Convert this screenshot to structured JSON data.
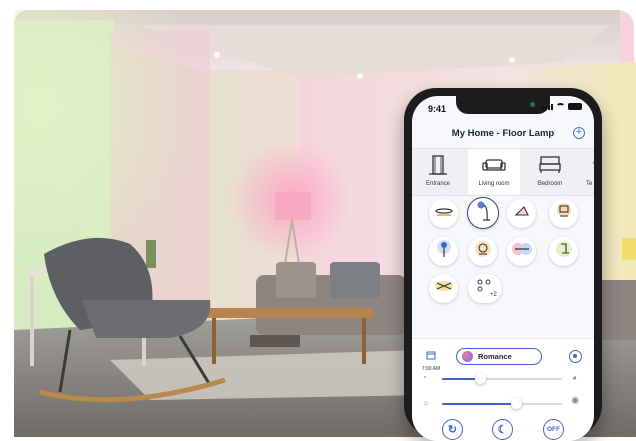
{
  "status": {
    "time": "9:41"
  },
  "header": {
    "title": "My Home - Floor Lamp",
    "add_icon": "plus-circle-icon"
  },
  "rooms": [
    {
      "label": "Entrance",
      "icon": "door-icon",
      "active": false
    },
    {
      "label": "Living room",
      "icon": "sofa-icon",
      "active": true
    },
    {
      "label": "Bedroom",
      "icon": "bed-icon",
      "active": false
    },
    {
      "label": "Te",
      "icon": "lamp-icon",
      "active": false
    }
  ],
  "lamps": [
    {
      "icon": "ceiling-light-icon",
      "selected": false
    },
    {
      "icon": "floor-lamp-icon",
      "selected": true
    },
    {
      "icon": "triangle-lamp-icon",
      "selected": false
    },
    {
      "icon": "table-lamp-icon",
      "selected": false
    },
    {
      "icon": "bulb-icon",
      "selected": false
    },
    {
      "icon": "round-lamp-icon",
      "selected": false
    },
    {
      "icon": "strip-light-icon",
      "selected": false
    },
    {
      "icon": "desk-lamp-icon",
      "selected": false
    },
    {
      "icon": "spot-light-icon",
      "selected": false
    }
  ],
  "group": {
    "more_label": "+2"
  },
  "controls": {
    "schedule_time": "7:00 AM",
    "scene_label": "Romance",
    "color_temp_level": 0.32,
    "brightness_level": 0.62,
    "off_label": "OFF",
    "accent_color": "#3f65c9"
  }
}
